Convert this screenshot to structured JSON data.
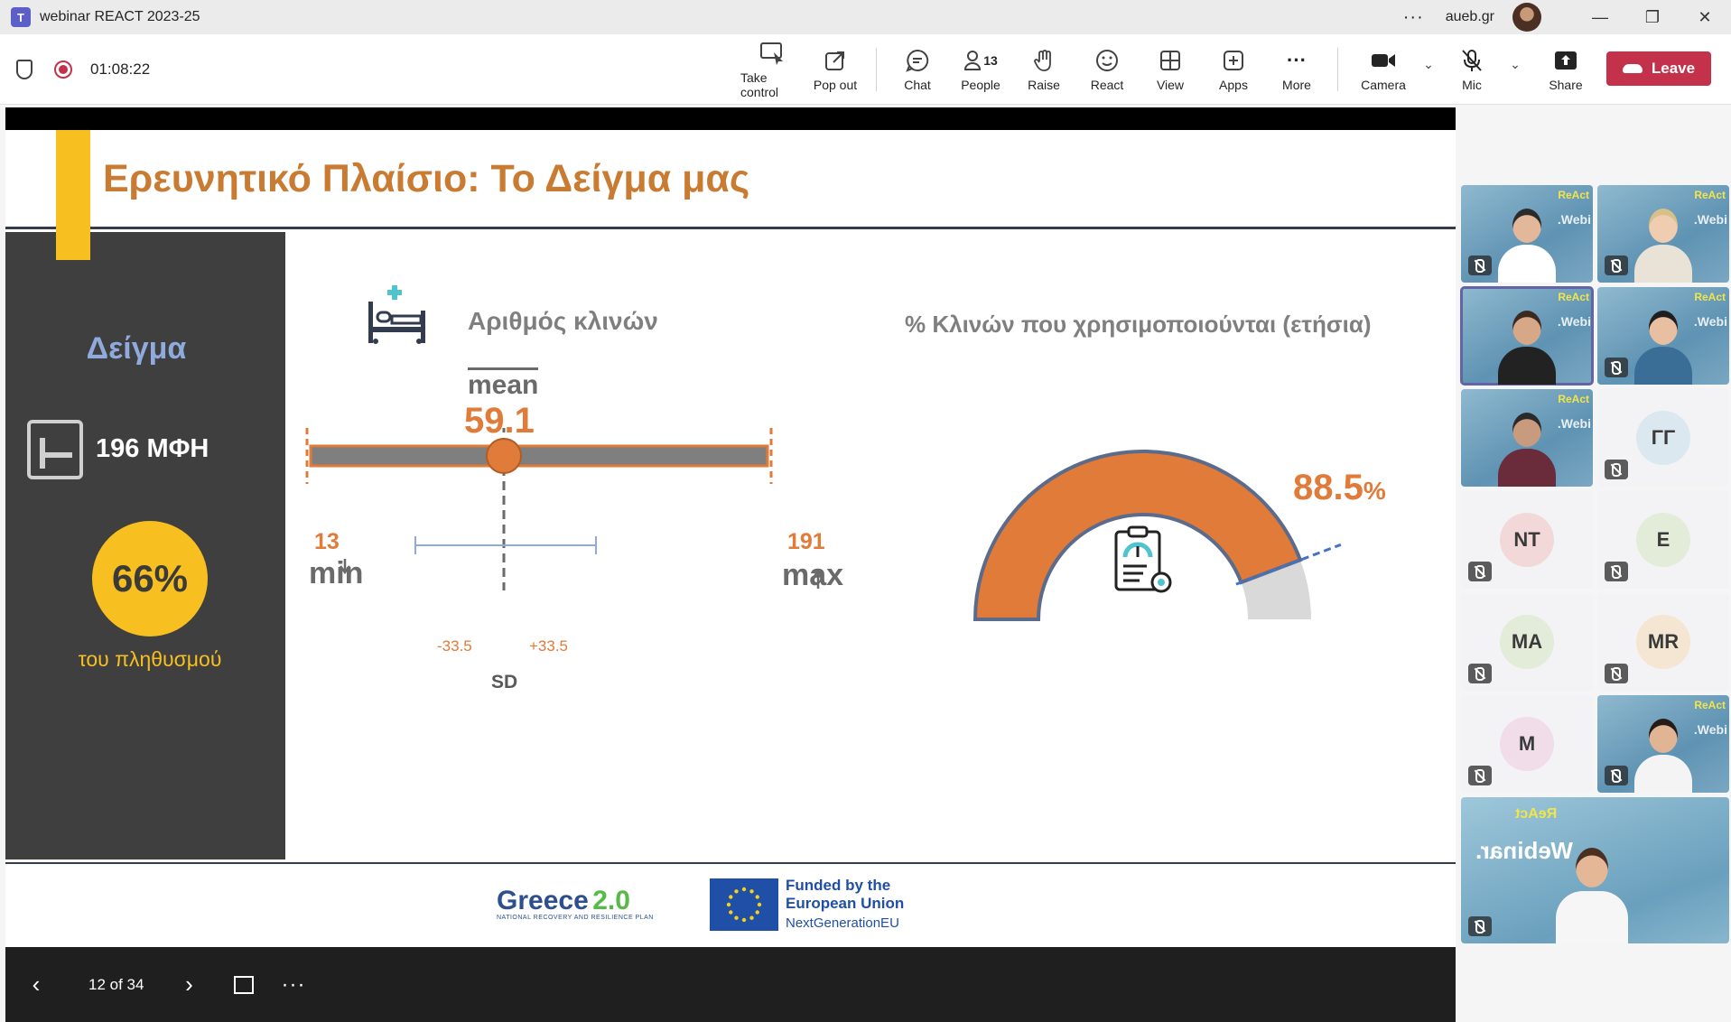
{
  "window": {
    "title": "webinar REACT 2023-25",
    "org": "aueb.gr",
    "more": "···"
  },
  "toolbar": {
    "timer": "01:08:22",
    "take_control": "Take control",
    "pop_out": "Pop out",
    "chat": "Chat",
    "people": "People",
    "people_count": "13",
    "raise": "Raise",
    "react": "React",
    "view": "View",
    "apps": "Apps",
    "more": "More",
    "camera": "Camera",
    "mic": "Mic",
    "share": "Share",
    "leave": "Leave"
  },
  "slide": {
    "title": "Ερευνητικό Πλαίσιο: Το Δείγμα μας",
    "sample_heading": "Δείγμα",
    "units": "196 ΜΦΗ",
    "population_pct": "66%",
    "population_label": "του πληθυσμού",
    "beds_title": "Αριθμός κλινών",
    "used_title": "% Κλινών που χρησιμοποιούνται (ετήσια)",
    "mean_label": "mean",
    "mean_value": "59.1",
    "min_value": "13",
    "min_label": "min",
    "max_value": "191",
    "max_label": "max",
    "sd_minus": "-33.5",
    "sd_plus": "+33.5",
    "sd_label": "SD",
    "gauge_value": "88.5",
    "gauge_unit": "%",
    "gauge_fraction": 0.885,
    "footer_greece": "Greece",
    "footer_version": "2.0",
    "footer_plan": "NATIONAL RECOVERY AND RESILIENCE PLAN",
    "footer_funded": "Funded by the",
    "footer_eu": "European Union",
    "footer_next": "NextGenerationEU"
  },
  "colors": {
    "accent_orange": "#e07b39",
    "title_orange": "#c97b32",
    "yellow": "#f7bf1f",
    "dark_panel": "#3f3f3f",
    "leave_red": "#c4314b"
  },
  "slide_controls": {
    "page": "12 of 34"
  },
  "participants": [
    {
      "type": "video",
      "initials": "",
      "mic_off": true
    },
    {
      "type": "video",
      "initials": "",
      "mic_off": true
    },
    {
      "type": "video",
      "initials": "",
      "mic_off": false,
      "active": true
    },
    {
      "type": "video",
      "initials": "",
      "mic_off": true
    },
    {
      "type": "video",
      "initials": "",
      "mic_off": false
    },
    {
      "type": "avatar",
      "initials": "ΓΓ",
      "mic_off": true,
      "color": "#dbe8ef"
    },
    {
      "type": "avatar",
      "initials": "NT",
      "mic_off": true,
      "color": "#f2d8d8"
    },
    {
      "type": "avatar",
      "initials": "E",
      "mic_off": true,
      "color": "#e2ecd9"
    },
    {
      "type": "avatar",
      "initials": "MA",
      "mic_off": true,
      "color": "#e2ecd9"
    },
    {
      "type": "avatar",
      "initials": "MR",
      "mic_off": true,
      "color": "#f4e6d2"
    },
    {
      "type": "avatar",
      "initials": "M",
      "mic_off": true,
      "color": "#f0dde9"
    },
    {
      "type": "video",
      "initials": "",
      "mic_off": true
    }
  ],
  "presenter": {
    "brand": "ReAct",
    "webinar": "Webinar."
  }
}
